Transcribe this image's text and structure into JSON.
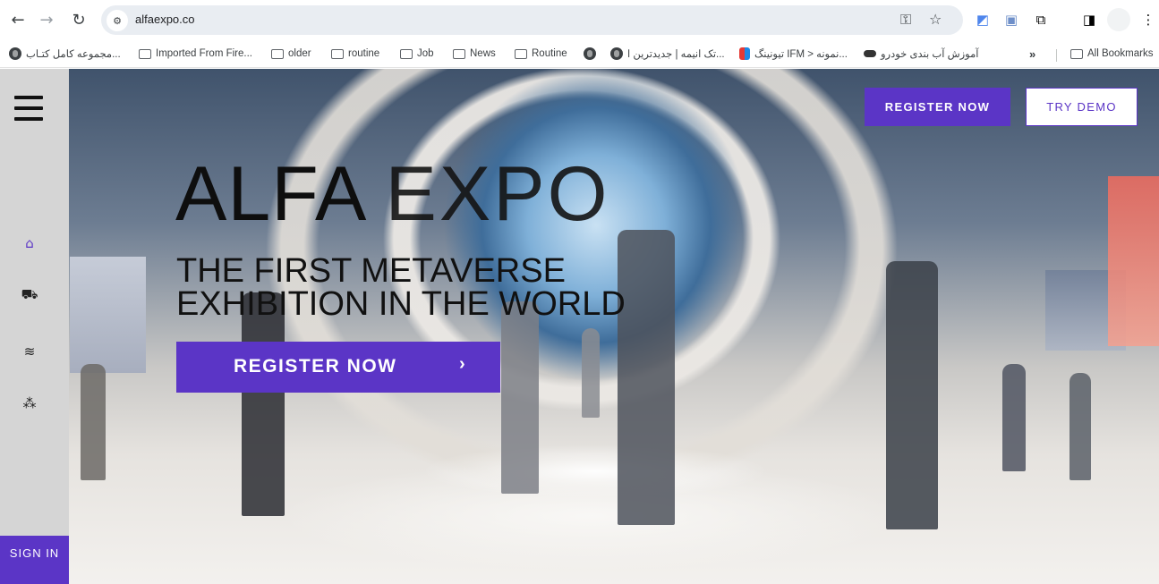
{
  "browser": {
    "url": "alfaexpo.co",
    "icons": {
      "back": "←",
      "forward": "→",
      "reload": "↻",
      "site_info": "⚙",
      "password_key": "⚿",
      "star": "☆",
      "extension_puzzle": "⧉",
      "sidebar": "◨",
      "menu": "⋮",
      "more_bookmarks": "»"
    },
    "bookmarks": [
      {
        "label": "مجموعه کامل کتـاب...",
        "icon": "globe"
      },
      {
        "label": "Imported From Fire...",
        "icon": "folder"
      },
      {
        "label": "older",
        "icon": "folder"
      },
      {
        "label": "routine",
        "icon": "folder"
      },
      {
        "label": "Job",
        "icon": "folder"
      },
      {
        "label": "News",
        "icon": "folder"
      },
      {
        "label": "Routine",
        "icon": "folder"
      },
      {
        "label": "تک انیمه | جدیدترین ا...",
        "icon": "globe"
      },
      {
        "label": "تیونینگ IFM > نمونه...",
        "icon": "site"
      },
      {
        "label": "آموزش آب بندی خودرو",
        "icon": "site"
      },
      {
        "label": "All Bookmarks",
        "icon": "folder"
      }
    ]
  },
  "page": {
    "accent_color": "#5b35c6",
    "sidenav": {
      "icons": {
        "home": "⌂",
        "map": "⛟",
        "layers": "≋",
        "group": "⁂"
      },
      "sign_in_label": "SIGN IN"
    },
    "header": {
      "register_label": "REGISTER NOW",
      "demo_label": "TRY DEMO"
    },
    "hero": {
      "title_bold": "ALFA",
      "title_thin": "EXPO",
      "subtitle_line1": "THE FIRST METAVERSE",
      "subtitle_line2": "EXHIBITION IN THE WORLD",
      "cta_label": "REGISTER NOW",
      "cta_chevron": "›"
    }
  }
}
